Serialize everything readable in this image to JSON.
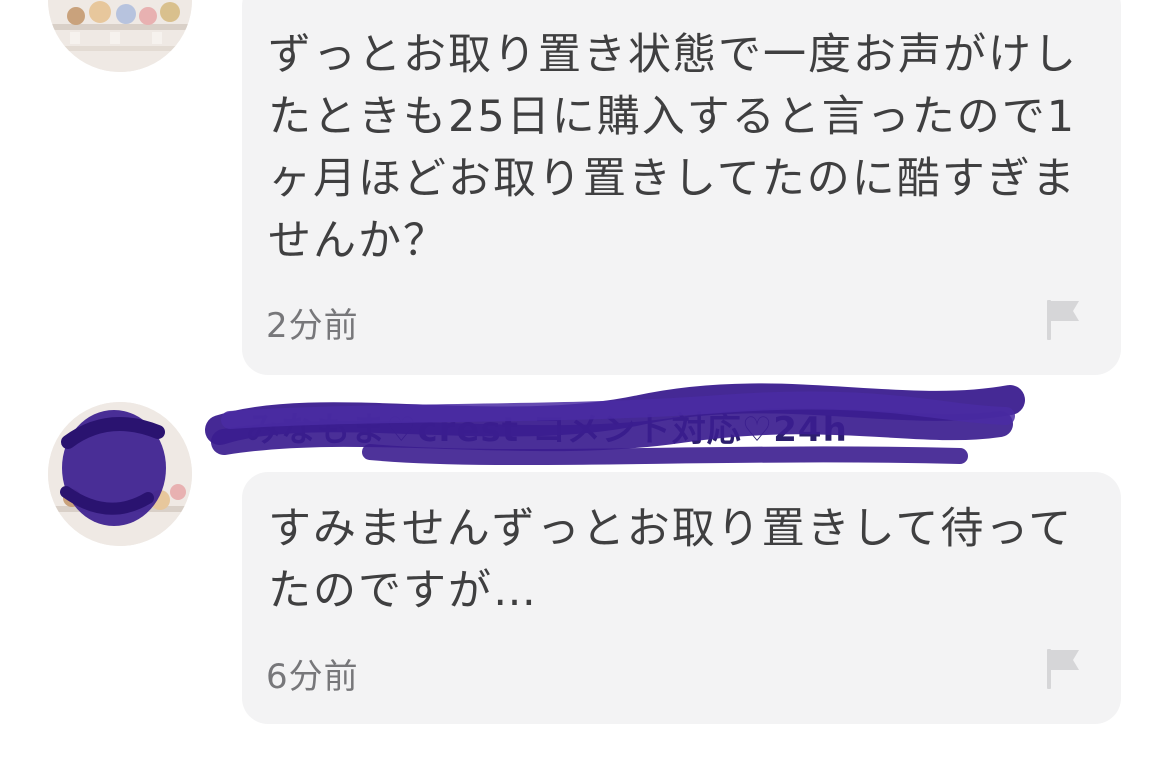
{
  "comments": [
    {
      "text": "ずっとお取り置き状態で一度お声がけし\nたときも25日に購入すると言ったので1\nヶ月ほどお取り置きしてたのに酷すぎま\nせんか？",
      "time": "2分前"
    },
    {
      "username": "みなもま♡crest コメント対応♡24h",
      "text": "すみませんずっとお取り置きして待って\nたのですが…",
      "time": "6分前"
    }
  ],
  "icons": {
    "report": "flag-icon"
  },
  "colors": {
    "bubble_bg": "#f3f3f4",
    "text": "#3f3f40",
    "timestamp": "#77777a",
    "flag": "#d6d6d8",
    "redaction": "#3b1d8f"
  }
}
